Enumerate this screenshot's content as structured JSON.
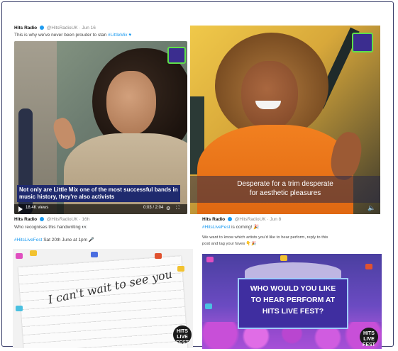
{
  "tweet1": {
    "account_name": "Hits Radio",
    "handle": "@HitsRadioUK · Jun 16",
    "text": "This is why we've never been prouder to stan ",
    "text_link": "#LittleMix",
    "video": {
      "caption": "Not only are Little Mix one of the most successful bands in music history, they're also activists",
      "views": "18.4K views",
      "time": "0:03 / 2:04",
      "logo_text": "HITS"
    }
  },
  "tweet2": {
    "video": {
      "caption_line1": "Desperate for a trim desperate",
      "caption_line2": "for aesthetic pleasures",
      "logo_text": "HITS RADIO"
    }
  },
  "tweet3": {
    "account_name": "Hits Radio",
    "handle": "@HitsRadioUK · 16h",
    "text": "Who recognises this handwriting 👀",
    "hashtag": "#HitsLiveFest",
    "date_text": "Sat 20th June at 1pm 🎤",
    "image_text_line1": "I can't wait to see you",
    "fest_badge": "HITS LIVE FEST"
  },
  "tweet4": {
    "account_name": "Hits Radio",
    "handle": "@HitsRadioUK · Jun 8",
    "text_link": "#HitsLiveFest",
    "text": " is coming! 🎉",
    "line2": "We want to know which artists you'd like to hear perform, reply to this",
    "line3": "post and tag your faves 👇🎉",
    "image_text": [
      "WHO WOULD YOU LIKE",
      "TO HEAR PERFORM AT",
      "HITS LIVE FEST?"
    ],
    "fest_badge": "HITS LIVE FEST"
  },
  "colors": {
    "frame": "#3a3f6b",
    "link": "#1d9bf0",
    "caption_bg": "#1f2a6e",
    "orange_top": "#f28020",
    "fest_panel": "#3f2ea0"
  }
}
